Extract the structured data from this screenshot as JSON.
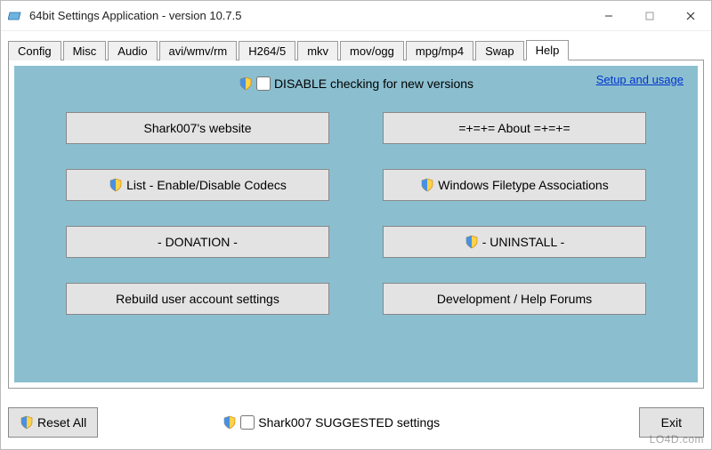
{
  "window": {
    "title": "64bit Settings Application - version 10.7.5"
  },
  "tabs": [
    {
      "label": "Config"
    },
    {
      "label": "Misc"
    },
    {
      "label": "Audio"
    },
    {
      "label": "avi/wmv/rm"
    },
    {
      "label": "H264/5"
    },
    {
      "label": "mkv"
    },
    {
      "label": "mov/ogg"
    },
    {
      "label": "mpg/mp4"
    },
    {
      "label": "Swap"
    },
    {
      "label": "Help",
      "active": true
    }
  ],
  "help": {
    "disable_label": "DISABLE checking for new versions",
    "setup_link": "Setup and usage",
    "buttons": {
      "website": "Shark007's website",
      "about": "=+=+= About =+=+=",
      "codecs": "List - Enable/Disable Codecs",
      "filetype": "Windows Filetype Associations",
      "donation": "- DONATION -",
      "uninstall": "- UNINSTALL -",
      "rebuild": "Rebuild user account settings",
      "forums": "Development / Help Forums"
    }
  },
  "bottom": {
    "reset": "Reset All",
    "suggested": "Shark007 SUGGESTED settings",
    "exit": "Exit"
  },
  "watermark": "LO4D.com"
}
